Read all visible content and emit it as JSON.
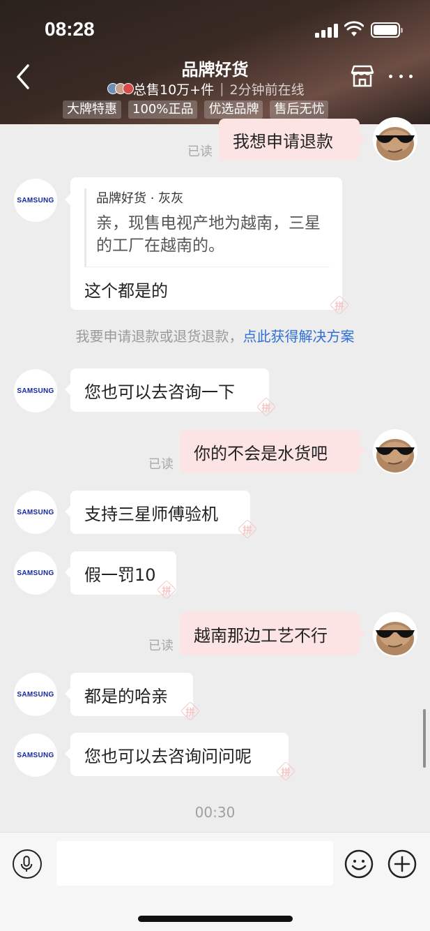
{
  "status_bar": {
    "time": "08:28"
  },
  "header": {
    "title": "品牌好货",
    "sales": "总售10万+件",
    "online": "2分钟前在线",
    "tags": [
      "大牌特惠",
      "100%正品",
      "优选品牌",
      "售后无忧"
    ]
  },
  "samsung_logo": "SAMSUNG",
  "messages": {
    "m1": {
      "text": "我想申请退款",
      "read": "已读"
    },
    "quote": {
      "author": "品牌好货 · 灰灰",
      "text": "亲，现售电视产地为越南，三星的工厂在越南的。",
      "reply": "这个都是的"
    },
    "system": {
      "prefix": "我要申请退款或退货退款，",
      "link": "点此获得解决方案"
    },
    "m2": {
      "text": "您也可以去咨询一下"
    },
    "m3": {
      "text": "你的不会是水货吧",
      "read": "已读"
    },
    "m4": {
      "text": "支持三星师傅验机"
    },
    "m5": {
      "text": "假一罚10"
    },
    "m6": {
      "text": "越南那边工艺不行",
      "read": "已读"
    },
    "m7": {
      "text": "都是的哈亲"
    },
    "m8": {
      "text": "您也可以去咨询问问呢"
    },
    "timestamp": "00:30"
  },
  "badge_mark": "拼",
  "input": {
    "placeholder": ""
  },
  "colors": {
    "bubble_right": "#fde4e4",
    "link": "#2f6fd6",
    "samsung_blue": "#1428a0"
  }
}
